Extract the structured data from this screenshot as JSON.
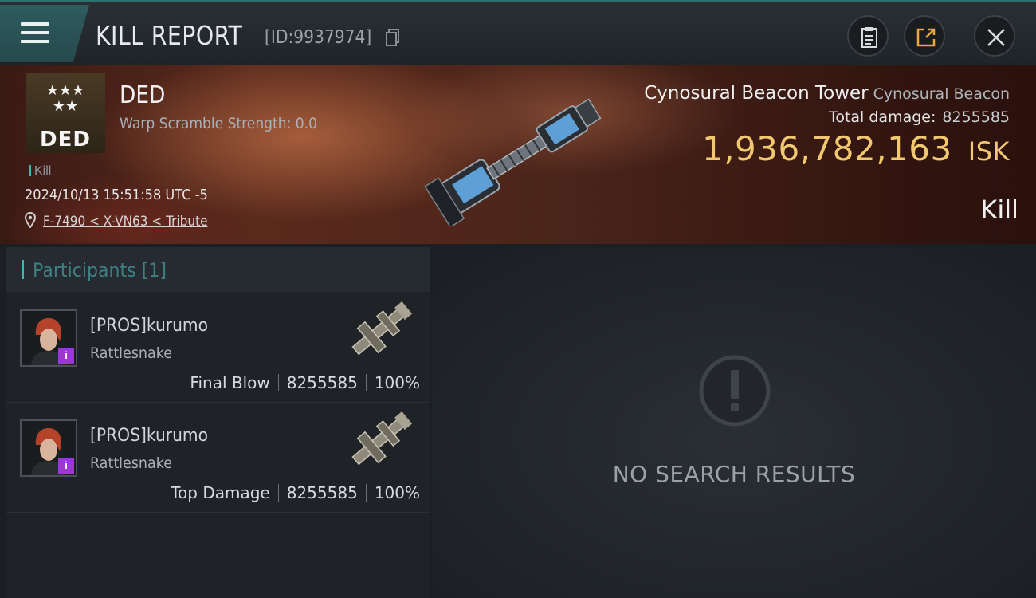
{
  "header": {
    "title": "KILL REPORT",
    "report_id": "[ID:9937974]"
  },
  "victim": {
    "corp_logo_text": "DED",
    "name": "DED",
    "warp_scramble": "Warp Scramble Strength: 0.0",
    "kill_tag": "Kill",
    "timestamp": "2024/10/13 15:51:58 UTC -5",
    "location": "F-7490 < X-VN63 < Tribute",
    "structure_name": "Cynosural Beacon Tower",
    "structure_type": "Cynosural Beacon",
    "total_damage_label": "Total damage:",
    "total_damage": "8255585",
    "isk_value": "1,936,782,163",
    "isk_unit": "ISK",
    "result_label": "Kill"
  },
  "participants": {
    "title": "Participants [1]",
    "rows": [
      {
        "name": "[PROS]kurumo",
        "ship": "Rattlesnake",
        "role": "Final Blow",
        "damage": "8255585",
        "percent": "100%"
      },
      {
        "name": "[PROS]kurumo",
        "ship": "Rattlesnake",
        "role": "Top Damage",
        "damage": "8255585",
        "percent": "100%"
      }
    ]
  },
  "detail_panel": {
    "empty_text": "NO SEARCH RESULTS"
  },
  "colors": {
    "accent": "#3fb7b0",
    "isk": "#f1c770",
    "badge": "#9a37d6"
  }
}
